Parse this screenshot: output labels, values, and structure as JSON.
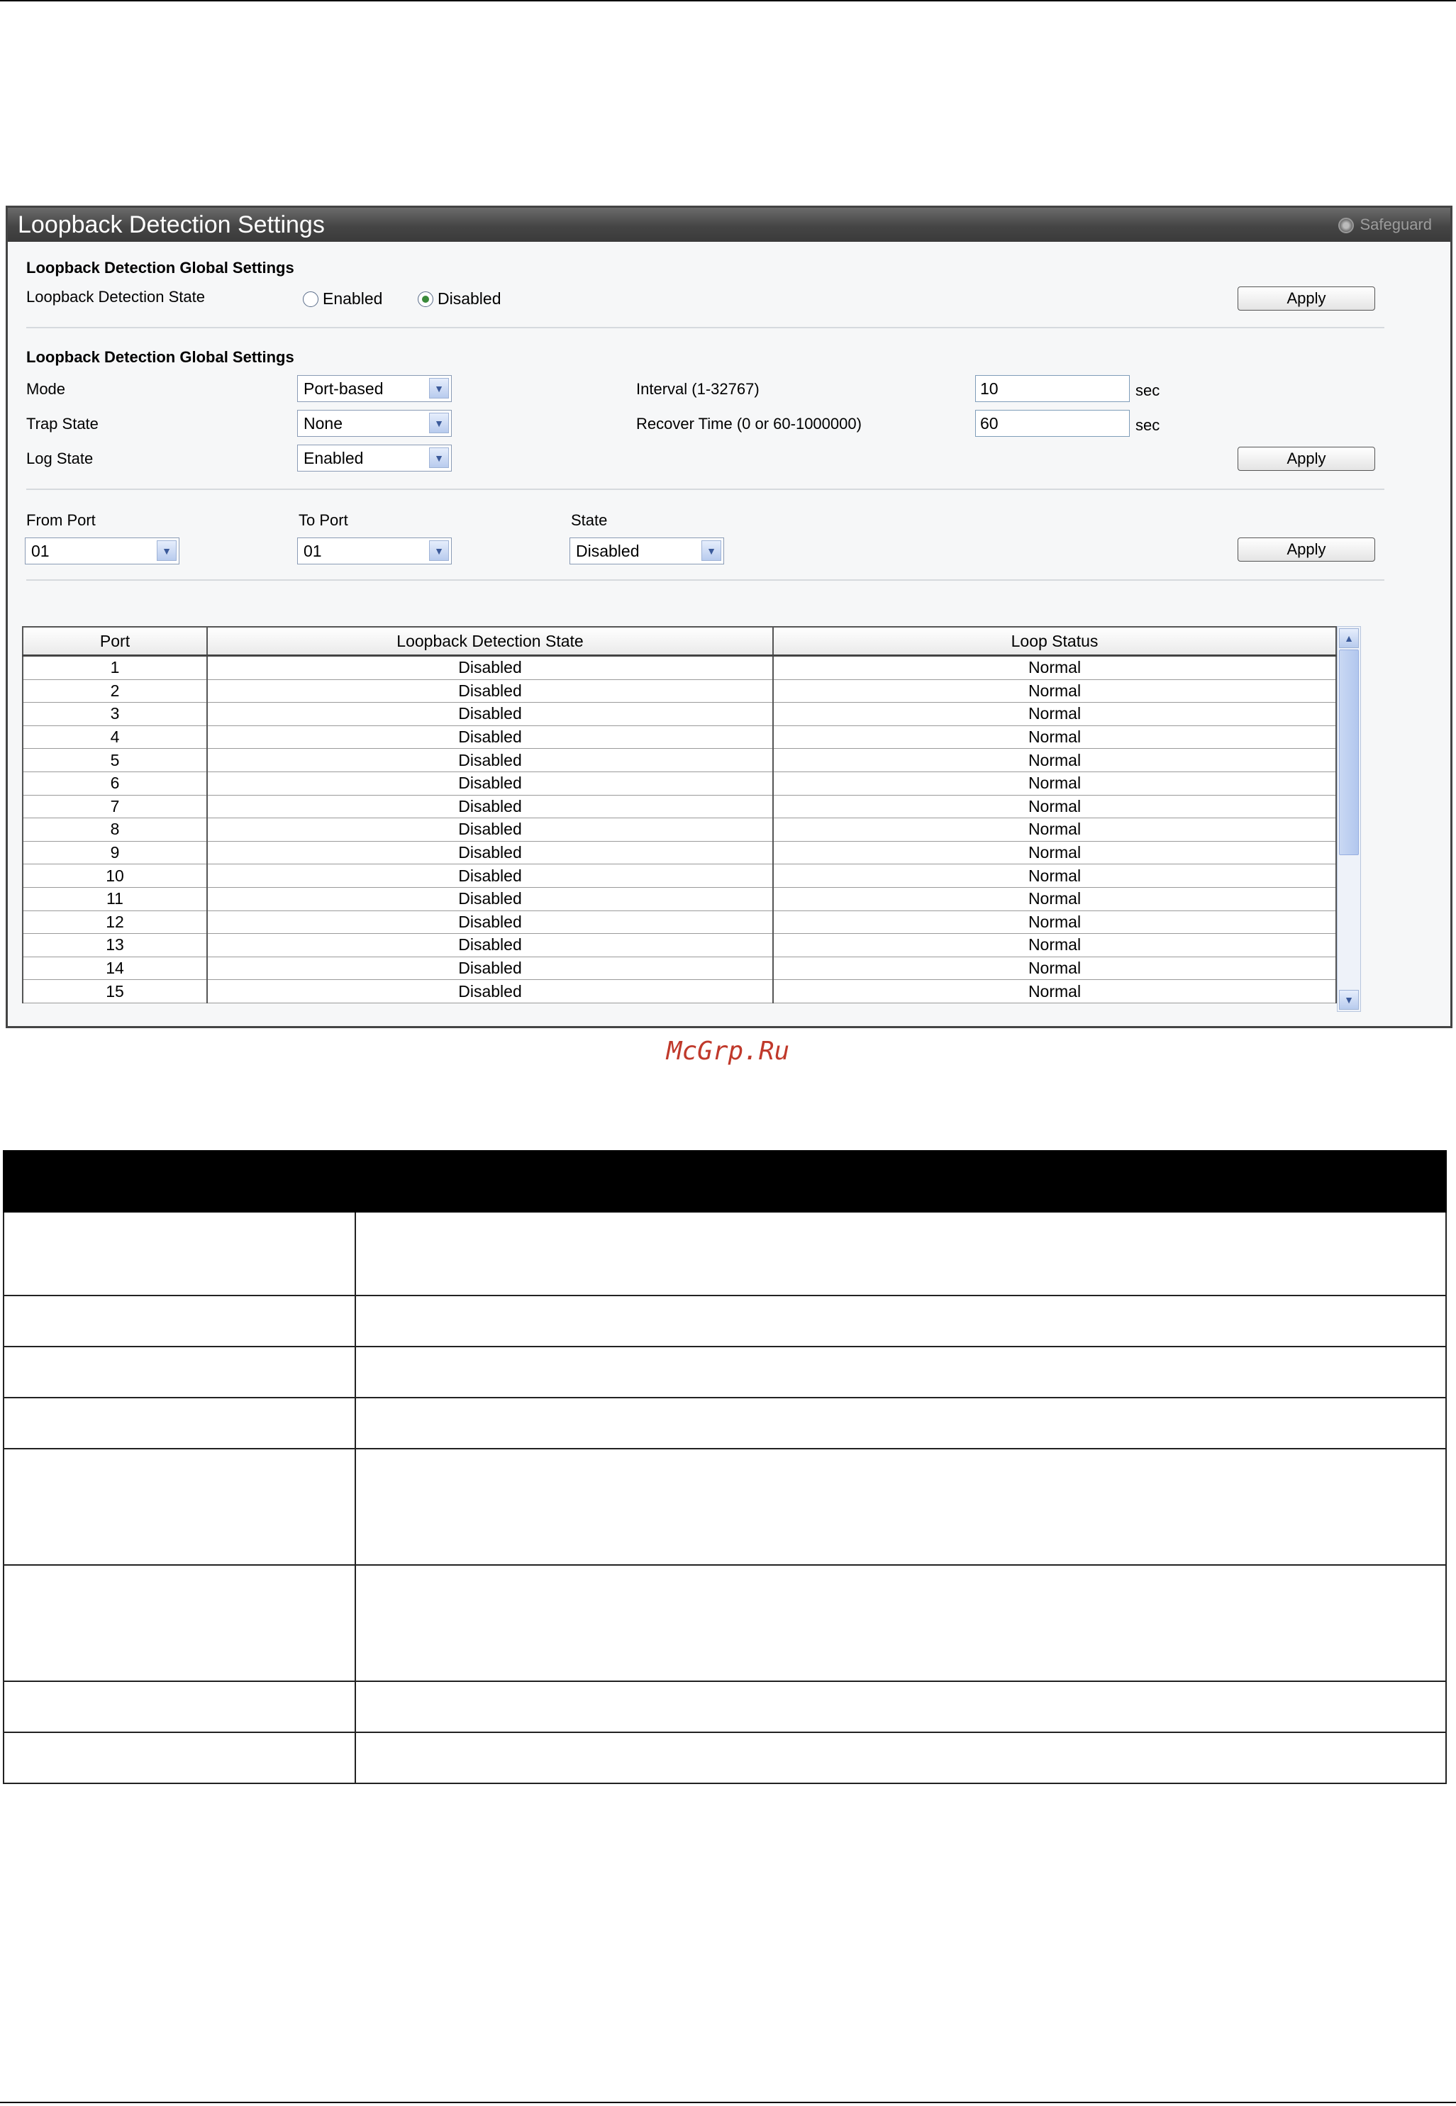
{
  "panel": {
    "title": "Loopback Detection Settings",
    "safeguard": "Safeguard"
  },
  "global_state": {
    "section_title": "Loopback Detection Global Settings",
    "label": "Loopback Detection State",
    "option_enabled": "Enabled",
    "option_disabled": "Disabled",
    "selected": "Disabled",
    "apply": "Apply"
  },
  "global_settings": {
    "section_title": "Loopback Detection Global Settings",
    "mode_label": "Mode",
    "mode_value": "Port-based",
    "trap_label": "Trap State",
    "trap_value": "None",
    "log_label": "Log State",
    "log_value": "Enabled",
    "interval_label": "Interval (1-32767)",
    "interval_value": "10",
    "interval_unit": "sec",
    "recover_label": "Recover Time (0 or 60-1000000)",
    "recover_value": "60",
    "recover_unit": "sec",
    "apply": "Apply"
  },
  "port_settings": {
    "from_label": "From Port",
    "from_value": "01",
    "to_label": "To Port",
    "to_value": "01",
    "state_label": "State",
    "state_value": "Disabled",
    "apply": "Apply"
  },
  "port_table": {
    "columns": [
      "Port",
      "Loopback Detection State",
      "Loop Status"
    ],
    "rows": [
      [
        "1",
        "Disabled",
        "Normal"
      ],
      [
        "2",
        "Disabled",
        "Normal"
      ],
      [
        "3",
        "Disabled",
        "Normal"
      ],
      [
        "4",
        "Disabled",
        "Normal"
      ],
      [
        "5",
        "Disabled",
        "Normal"
      ],
      [
        "6",
        "Disabled",
        "Normal"
      ],
      [
        "7",
        "Disabled",
        "Normal"
      ],
      [
        "8",
        "Disabled",
        "Normal"
      ],
      [
        "9",
        "Disabled",
        "Normal"
      ],
      [
        "10",
        "Disabled",
        "Normal"
      ],
      [
        "11",
        "Disabled",
        "Normal"
      ],
      [
        "12",
        "Disabled",
        "Normal"
      ],
      [
        "13",
        "Disabled",
        "Normal"
      ],
      [
        "14",
        "Disabled",
        "Normal"
      ],
      [
        "15",
        "Disabled",
        "Normal"
      ]
    ]
  },
  "watermark": "McGrp.Ru",
  "icons": {
    "dropdown": "chevron-down-icon",
    "scroll_up": "chevron-up-icon",
    "scroll_down": "chevron-down-icon",
    "safeguard": "safeguard-indicator-icon"
  }
}
